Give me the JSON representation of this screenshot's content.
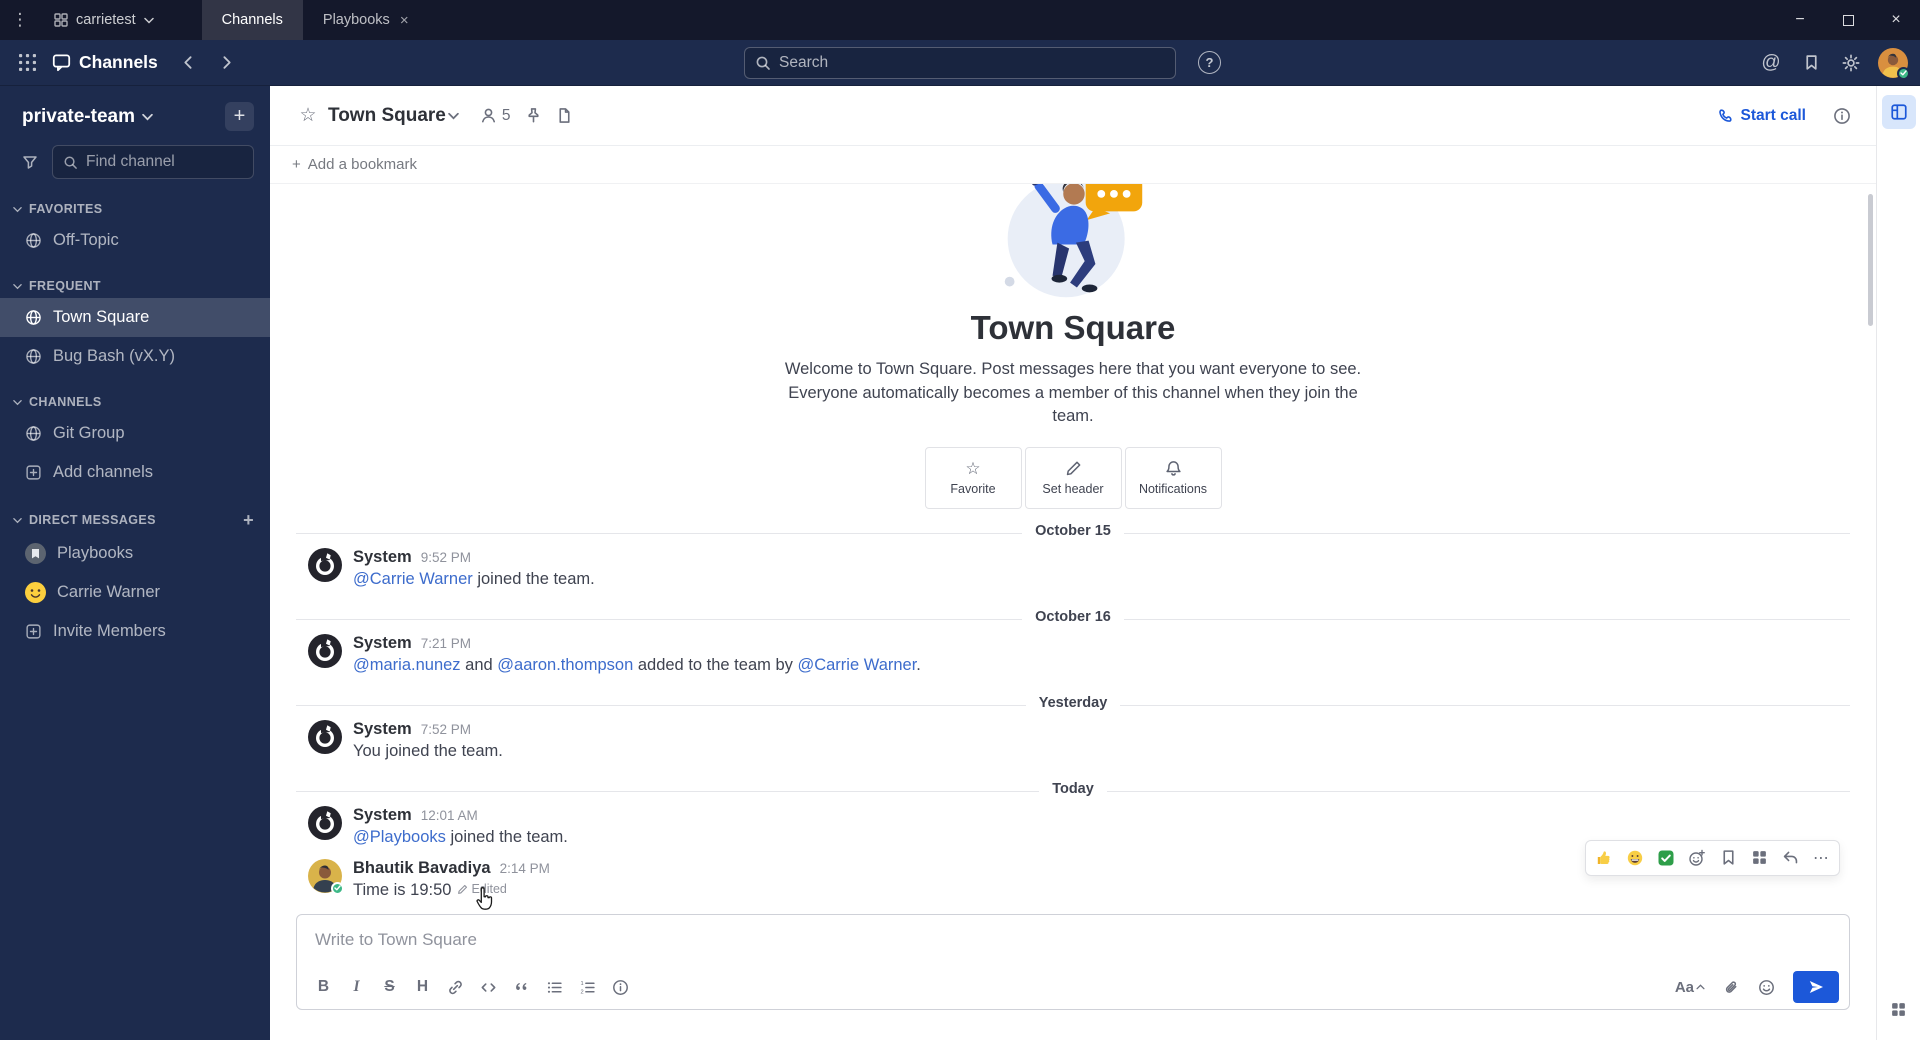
{
  "colors": {
    "accent": "#1c58d9",
    "link": "#3d6ccc",
    "online": "#3db887",
    "sidebar_bg": "#1d2b4d",
    "titlebar_bg": "#14182b"
  },
  "glyphs": {
    "kebab": "⋮",
    "minimize": "−",
    "close": "×",
    "tab_close": "×",
    "at": "@",
    "question": "?",
    "star": "☆",
    "plus": "+",
    "ellipsis": "⋯"
  },
  "titlebar": {
    "team_selector": "carrietest",
    "tab_channels": "Channels",
    "tab_playbooks": "Playbooks"
  },
  "header": {
    "product": "Channels",
    "search_placeholder": "Search"
  },
  "sidebar": {
    "team": "private-team",
    "find_placeholder": "Find channel",
    "section_favorites": "FAVORITES",
    "section_frequent": "FREQUENT",
    "section_channels": "CHANNELS",
    "section_dms": "DIRECT MESSAGES",
    "off_topic": "Off-Topic",
    "town_square": "Town Square",
    "bug_bash": "Bug Bash (vX.Y)",
    "git_group": "Git Group",
    "add_channels": "Add channels",
    "playbooks_dm": "Playbooks",
    "carrie_dm": "Carrie Warner",
    "invite_members": "Invite Members"
  },
  "channel_header": {
    "name": "Town Square",
    "member_count": "5",
    "start_call": "Start call"
  },
  "bookmark_bar": {
    "label": "Add a bookmark"
  },
  "intro": {
    "title": "Town Square",
    "description": "Welcome to Town Square. Post messages here that you want everyone to see. Everyone automatically becomes a member of this channel when they join the team.",
    "favorite": "Favorite",
    "set_header": "Set header",
    "notifications": "Notifications"
  },
  "timeline": {
    "divider1": "October 15",
    "divider2": "October 16",
    "divider3": "Yesterday",
    "divider4": "Today",
    "msg1": {
      "sender": "System",
      "time": "9:52 PM",
      "link1": "@Carrie Warner",
      "text1": " joined the team."
    },
    "msg2": {
      "sender": "System",
      "time": "7:21 PM",
      "link1": "@maria.nunez",
      "text1": " and ",
      "link2": "@aaron.thompson",
      "text2": " added to the team by ",
      "link3": "@Carrie Warner",
      "text3": "."
    },
    "msg3": {
      "sender": "System",
      "time": "7:52 PM",
      "text1": "You joined the team."
    },
    "msg4": {
      "sender": "System",
      "time": "12:01 AM",
      "link1": "@Playbooks",
      "text1": " joined the team."
    },
    "msg5": {
      "sender": "Bhautik Bavadiya",
      "time": "2:14 PM",
      "text1": "Time is 19:50",
      "edited": "Edited"
    }
  },
  "composer": {
    "placeholder": "Write to Town Square",
    "format_toggle": "Aa"
  }
}
